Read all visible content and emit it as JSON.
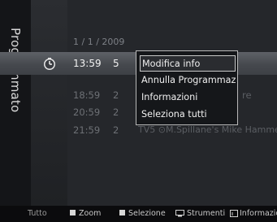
{
  "panel": {
    "title": "Programmato"
  },
  "list": {
    "date": "1 / 1 / 2009",
    "selected": {
      "time": "13:59",
      "channel": "5"
    },
    "rows": [
      {
        "time": "18:59",
        "channel": "2",
        "program": "re"
      },
      {
        "time": "20:59",
        "channel": "2",
        "program": ""
      },
      {
        "time": "21:59",
        "channel": "2",
        "program": "TV5  ⊙M.Spillane's Mike Hamme"
      }
    ]
  },
  "context_menu": {
    "items": [
      {
        "label": "Modifica info",
        "active": true
      },
      {
        "label": "Annulla Programmazioni",
        "active": false
      },
      {
        "label": "Informazioni",
        "active": false
      },
      {
        "label": "Seleziona tutti",
        "active": false
      }
    ]
  },
  "bottom_bar": {
    "tutto": "Tutto",
    "zoom": "Zoom",
    "selezione": "Selezione",
    "strumenti": "Strumenti",
    "informazioni": "Informazioni"
  },
  "colors": {
    "accent": "#b8b8b8",
    "background": "#101113"
  }
}
